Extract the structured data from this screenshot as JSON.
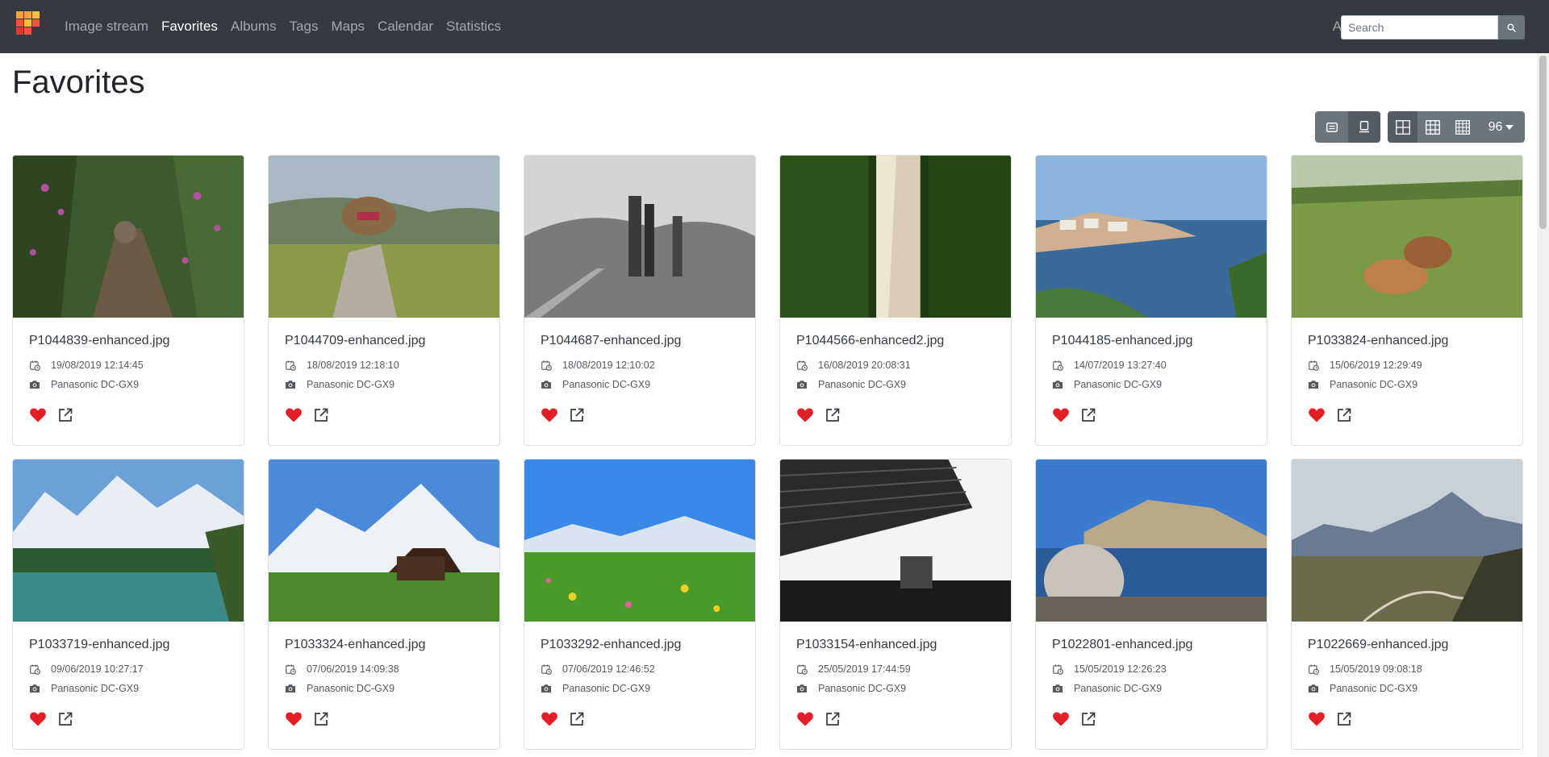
{
  "navbar": {
    "links": [
      {
        "label": "Image stream"
      },
      {
        "label": "Favorites",
        "active": true
      },
      {
        "label": "Albums"
      },
      {
        "label": "Tags"
      },
      {
        "label": "Maps"
      },
      {
        "label": "Calendar"
      },
      {
        "label": "Statistics"
      }
    ],
    "about": "About",
    "search_placeholder": "Search",
    "brand_colors": [
      "#f2a33a",
      "#e9573f",
      "#f5c040",
      "#d33f2e"
    ]
  },
  "page": {
    "title": "Favorites"
  },
  "toolbar": {
    "page_size": "96",
    "icons": [
      "list-view-icon",
      "card-view-icon",
      "grid-large-icon",
      "grid-medium-icon",
      "grid-small-icon"
    ]
  },
  "photos": [
    {
      "filename": "P1044839-enhanced.jpg",
      "date": "19/08/2019 12:14:45",
      "camera": "Panasonic DC-GX9"
    },
    {
      "filename": "P1044709-enhanced.jpg",
      "date": "18/08/2019 12:18:10",
      "camera": "Panasonic DC-GX9"
    },
    {
      "filename": "P1044687-enhanced.jpg",
      "date": "18/08/2019 12:10:02",
      "camera": "Panasonic DC-GX9"
    },
    {
      "filename": "P1044566-enhanced2.jpg",
      "date": "16/08/2019 20:08:31",
      "camera": "Panasonic DC-GX9"
    },
    {
      "filename": "P1044185-enhanced.jpg",
      "date": "14/07/2019 13:27:40",
      "camera": "Panasonic DC-GX9"
    },
    {
      "filename": "P1033824-enhanced.jpg",
      "date": "15/06/2019 12:29:49",
      "camera": "Panasonic DC-GX9"
    },
    {
      "filename": "P1033719-enhanced.jpg",
      "date": "09/06/2019 10:27:17",
      "camera": "Panasonic DC-GX9"
    },
    {
      "filename": "P1033324-enhanced.jpg",
      "date": "07/06/2019 14:09:38",
      "camera": "Panasonic DC-GX9"
    },
    {
      "filename": "P1033292-enhanced.jpg",
      "date": "07/06/2019 12:46:52",
      "camera": "Panasonic DC-GX9"
    },
    {
      "filename": "P1033154-enhanced.jpg",
      "date": "25/05/2019 17:44:59",
      "camera": "Panasonic DC-GX9"
    },
    {
      "filename": "P1022801-enhanced.jpg",
      "date": "15/05/2019 12:26:23",
      "camera": "Panasonic DC-GX9"
    },
    {
      "filename": "P1022669-enhanced.jpg",
      "date": "15/05/2019 09:08:18",
      "camera": "Panasonic DC-GX9"
    }
  ],
  "colors": {
    "navbar_bg": "#343a40",
    "favorite_heart": "#e41e26",
    "toolbar_btn": "#6c757d"
  }
}
